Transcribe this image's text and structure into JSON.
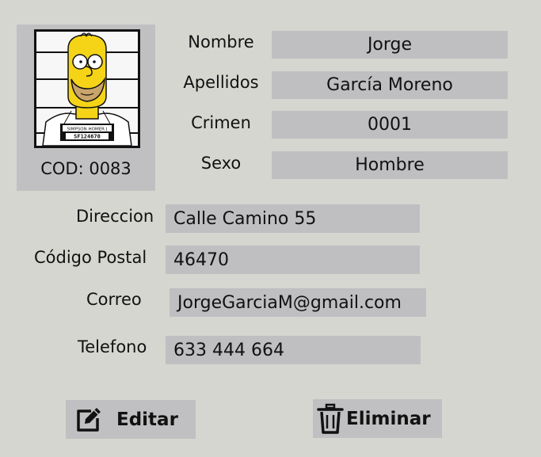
{
  "card": {
    "code_label": "COD: 0083"
  },
  "fields": {
    "nombre": {
      "label": "Nombre",
      "value": "Jorge"
    },
    "apellidos": {
      "label": "Apellidos",
      "value": "García Moreno"
    },
    "crimen": {
      "label": "Crimen",
      "value": "0001"
    },
    "sexo": {
      "label": "Sexo",
      "value": "Hombre"
    },
    "direccion": {
      "label": "Direccion",
      "value": "Calle Camino 55"
    },
    "codigo_postal": {
      "label": "Código Postal",
      "value": "46470"
    },
    "correo": {
      "label": "Correo",
      "value": "JorgeGarciaM@gmail.com"
    },
    "telefono": {
      "label": "Telefono",
      "value": "633 444 664"
    }
  },
  "buttons": {
    "edit": {
      "label": "Editar",
      "icon": "edit-icon"
    },
    "delete": {
      "label": "Eliminar",
      "icon": "trash-icon"
    }
  },
  "mugshot_sign": {
    "line1": "SIMPSON HOMER J",
    "line2": "SF124670"
  },
  "colors": {
    "background": "#d6d6d1",
    "field": "#bfbfc2",
    "text": "#111111"
  }
}
